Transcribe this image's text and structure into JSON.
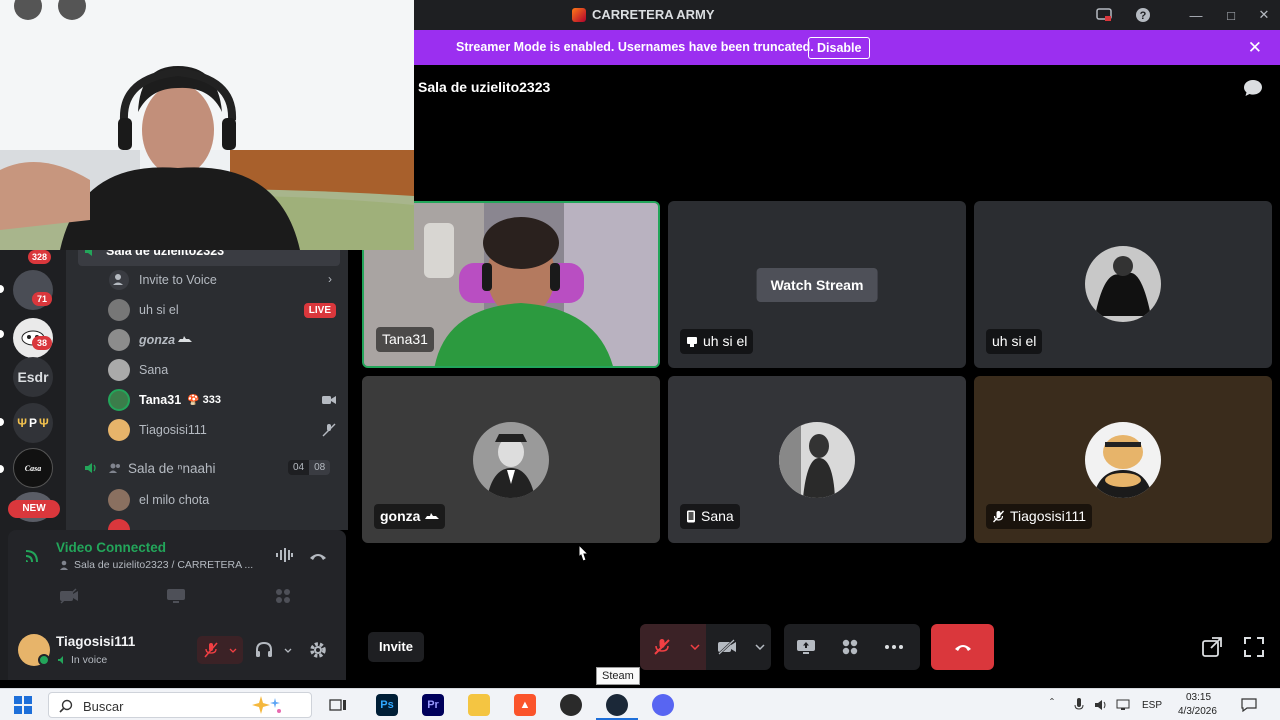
{
  "window": {
    "title": "CARRETERA ARMY"
  },
  "banner": {
    "text": "Streamer Mode is enabled. Usernames have been truncated.",
    "button": "Disable"
  },
  "room": {
    "title": "Sala de uzielito2323"
  },
  "tiles": [
    {
      "name": "Tana31",
      "speaking": true
    },
    {
      "name": "uh si el",
      "action": "Watch Stream",
      "streaming": true
    },
    {
      "name": "uh si el"
    },
    {
      "name": "gonza"
    },
    {
      "name": "Sana"
    },
    {
      "name": "Tiagosisi111",
      "muted": true
    }
  ],
  "controls": {
    "invite": "Invite"
  },
  "servers": {
    "badges": [
      "328",
      "71",
      "38"
    ],
    "text_server": "Esdr",
    "text_server2": "P",
    "new_label": "NEW"
  },
  "channels": {
    "current_channel": "Sala de uzielito2323",
    "invite_row": "Invite to Voice",
    "members": [
      {
        "name": "uh si el",
        "live": "LIVE"
      },
      {
        "name": "gonza"
      },
      {
        "name": "Sana"
      },
      {
        "name": "Tana31",
        "extra": "333"
      },
      {
        "name": "Tiagosisi111"
      }
    ],
    "second_channel": {
      "name": "Sala de ⁿnaahi",
      "count_a": "04",
      "count_b": "08"
    },
    "second_members": [
      {
        "name": "el milo chota"
      }
    ]
  },
  "voice_panel": {
    "status": "Video Connected",
    "location": "Sala de uzielito2323 / CARRETERA ...",
    "user_name": "Tiagosisi111",
    "user_status": "In voice"
  },
  "taskbar": {
    "search_placeholder": "Buscar",
    "tooltip": "Steam",
    "language": "ESP",
    "time": "03:15",
    "date": "4/3/2026"
  },
  "colors": {
    "banner": "#9b2ff0",
    "connected": "#23a55a",
    "danger": "#da373c",
    "speaking_ring": "#23a55a"
  }
}
